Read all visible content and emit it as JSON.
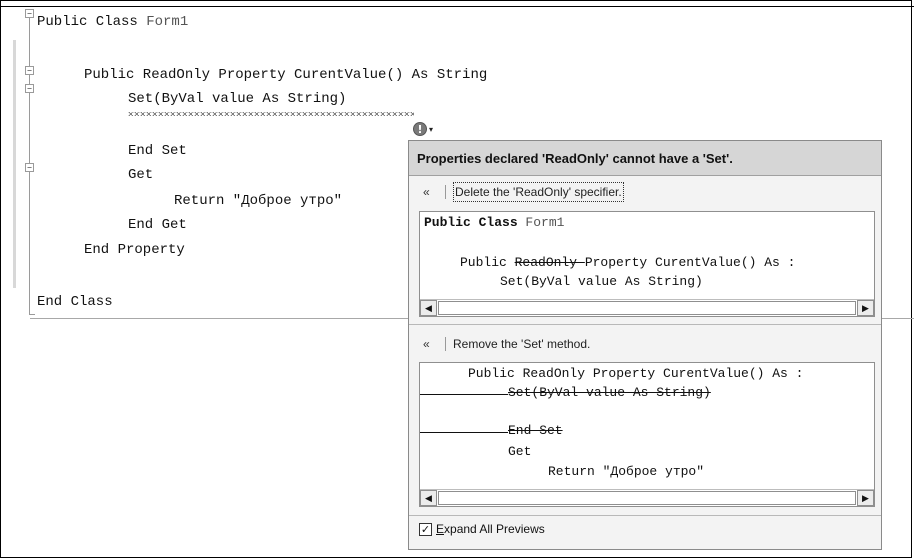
{
  "editor": {
    "lines": [
      {
        "keyword": "Public Class ",
        "ident": "Form1"
      },
      {
        "text": "Public ReadOnly Property CurentValue() As String"
      },
      {
        "text": "Set(ByVal value As String)"
      },
      {
        "text": "End Set"
      },
      {
        "text": "Get"
      },
      {
        "text": "Return \"Доброе утро\""
      },
      {
        "text": "End Get"
      },
      {
        "text": "End Property"
      },
      {
        "text": "End Class"
      }
    ]
  },
  "smart_tag": {
    "icon": "error-exclamation-icon",
    "glyph": "!",
    "dropdown": "▾"
  },
  "popup": {
    "header": "Properties declared 'ReadOnly' cannot have a 'Set'.",
    "fix1": {
      "label": "Delete the 'ReadOnly' specifier.",
      "preview": {
        "line1_a": "Public Class ",
        "line1_b": "Form1",
        "line2_a": "Public ",
        "line2_strike": "ReadOnly ",
        "line2_b": "Property CurentValue() As :",
        "line3": "Set(ByVal value As String)"
      }
    },
    "fix2": {
      "label": "Remove the 'Set' method.",
      "preview": {
        "line1": "Public ReadOnly Property CurentValue() As :",
        "line2": "Set(ByVal value As String)",
        "line3": "End Set",
        "line4": "Get",
        "line5": "Return \"Доброе утро\""
      }
    },
    "footer": {
      "checked": true,
      "check_glyph": "✓",
      "label_first": "E",
      "label_rest": "xpand All Previews"
    },
    "chevron": "«",
    "scroll_left": "◀",
    "scroll_right": "▶"
  }
}
